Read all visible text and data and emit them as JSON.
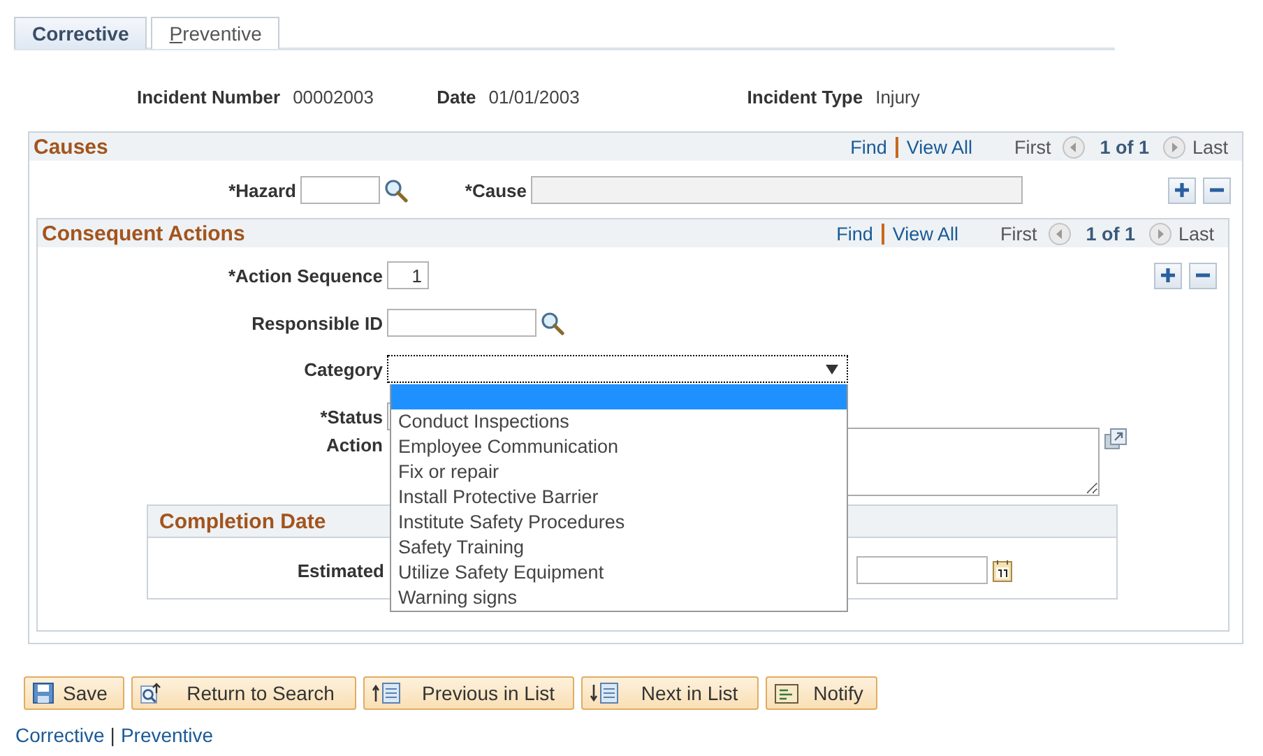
{
  "tabs": [
    {
      "label": "Corrective",
      "selected": true
    },
    {
      "label": "Preventive",
      "selected": false
    }
  ],
  "header": [
    {
      "label": "Incident Number",
      "value": "00002003"
    },
    {
      "label": "Date",
      "value": "01/01/2003"
    },
    {
      "label": "Incident Type",
      "value": "Injury"
    }
  ],
  "causes": {
    "title": "Causes",
    "find": "Find",
    "view_all": "View All",
    "first": "First",
    "count": "1 of 1",
    "last": "Last",
    "hazard": {
      "label": "*Hazard"
    },
    "cause": {
      "label": "*Cause",
      "disabled": true
    }
  },
  "consequent_actions": {
    "title": "Consequent Actions",
    "find": "Find",
    "view_all": "View All",
    "first": "First",
    "count": "1 of 1",
    "last": "Last",
    "action_sequence": {
      "label": "*Action Sequence",
      "value": "1"
    },
    "responsible_id": {
      "label": "Responsible ID"
    },
    "category": {
      "label": "Category",
      "open": true,
      "blank_highlighted": true,
      "options": [
        {
          "label": "Conduct Inspections",
          "selected": false
        },
        {
          "label": "Employee Communication",
          "selected": false
        },
        {
          "label": "Fix or repair",
          "selected": false
        },
        {
          "label": "Install Protective Barrier",
          "selected": false
        },
        {
          "label": "Institute Safety Procedures",
          "selected": false
        },
        {
          "label": "Safety Training",
          "selected": false
        },
        {
          "label": "Utilize Safety Equipment",
          "selected": false
        },
        {
          "label": "Warning signs",
          "selected": false
        }
      ]
    },
    "status": {
      "label": "*Status"
    },
    "action": {
      "label": "Action"
    },
    "completion_date": {
      "title": "Completion Date",
      "estimated_label": "Estimated"
    }
  },
  "buttons": [
    {
      "label": "Save",
      "kind": "save"
    },
    {
      "label": "Return to Search",
      "kind": "return"
    },
    {
      "label": "Previous in List",
      "kind": "previous"
    },
    {
      "label": "Next in List",
      "kind": "next"
    },
    {
      "label": "Notify",
      "kind": "notify"
    }
  ],
  "footer": {
    "links": [
      "Corrective",
      "Preventive"
    ],
    "separator": "|"
  }
}
